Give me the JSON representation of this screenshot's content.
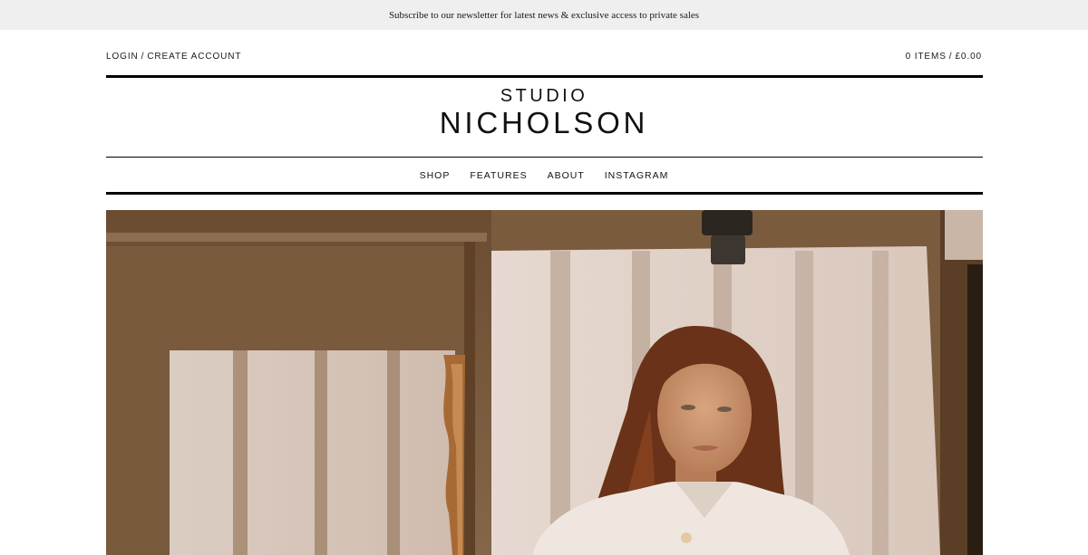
{
  "announcement": {
    "text": "Subscribe to our newsletter for latest news & exclusive access to private sales"
  },
  "account": {
    "login": "LOGIN",
    "separator": "/",
    "create": "CREATE ACCOUNT"
  },
  "cart": {
    "items": "0 ITEMS",
    "separator": "/",
    "total": "£0.00"
  },
  "logo": {
    "line1": "STUDIO",
    "line2": "NICHOLSON"
  },
  "nav": {
    "items": [
      {
        "label": "SHOP"
      },
      {
        "label": "FEATURES"
      },
      {
        "label": "ABOUT"
      },
      {
        "label": "INSTAGRAM"
      }
    ]
  },
  "hero": {
    "image": "fashion-editorial-photo"
  },
  "colors": {
    "announcement_bg": "#efefef",
    "rule": "#000000",
    "text": "#111111"
  }
}
